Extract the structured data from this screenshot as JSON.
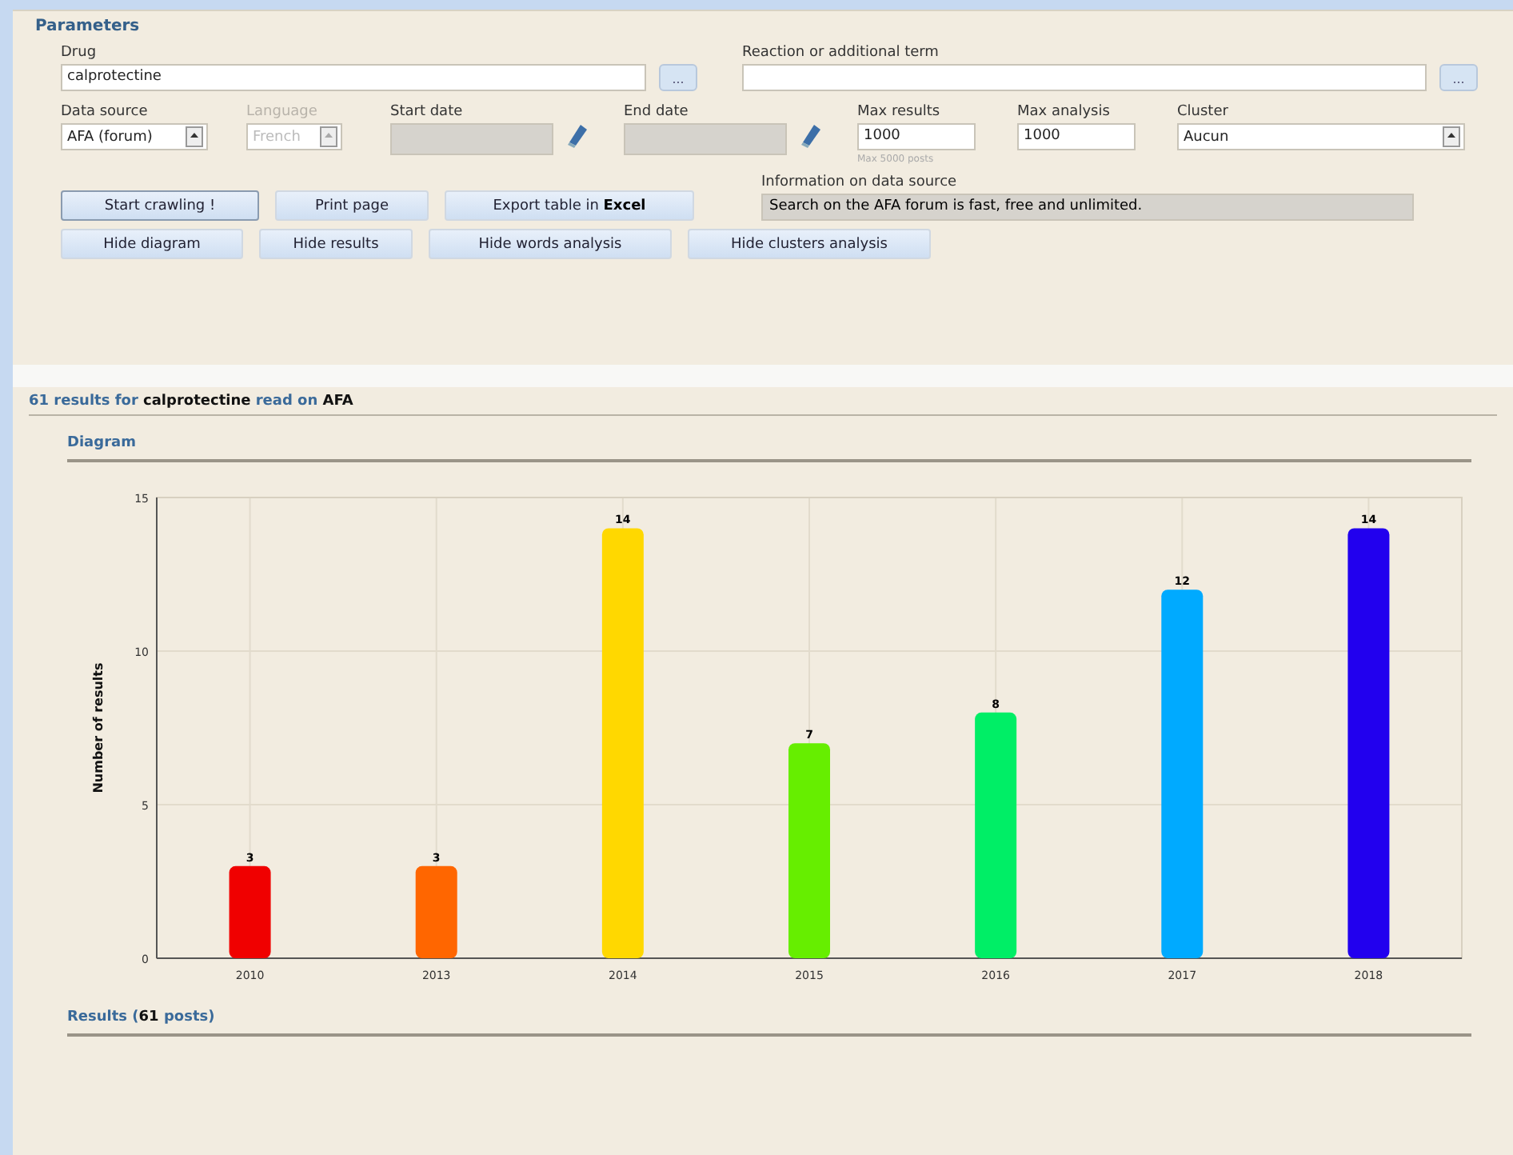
{
  "parameters": {
    "title": "Parameters",
    "drug": {
      "label": "Drug",
      "value": "calprotectine",
      "button": "..."
    },
    "reaction": {
      "label": "Reaction or additional term",
      "button": "..."
    },
    "data_source": {
      "label": "Data source",
      "value": "AFA (forum)"
    },
    "language": {
      "label": "Language",
      "value": "French",
      "disabled": true
    },
    "start_date": {
      "label": "Start date",
      "disabled": true
    },
    "end_date": {
      "label": "End date",
      "disabled": true
    },
    "max_results": {
      "label": "Max results",
      "value": "1000",
      "hint": "Max 5000 posts"
    },
    "max_analysis": {
      "label": "Max analysis",
      "value": "1000"
    },
    "cluster": {
      "label": "Cluster",
      "value": "Aucun"
    },
    "info": {
      "label": "Information on data source",
      "value": "Search on the AFA forum is fast, free and unlimited."
    },
    "action_buttons": [
      {
        "label": "Start crawling !",
        "focused": true
      },
      {
        "label": "Print page",
        "focused": false
      },
      {
        "label": "Export table in **Excel**",
        "focused": false
      }
    ],
    "toggle_buttons": [
      {
        "label": "Hide diagram"
      },
      {
        "label": "Hide results"
      },
      {
        "label": "Hide words analysis"
      },
      {
        "label": "Hide clusters analysis"
      }
    ]
  },
  "results_heading": "61 results for **calprotectine** read on **AFA**",
  "diagram": {
    "title": "Diagram",
    "chart_data": {
      "type": "bar",
      "ylabel": "Number of results",
      "categories": [
        "2010",
        "2013",
        "2014",
        "2015",
        "2016",
        "2017",
        "2018"
      ],
      "series": [
        {
          "values": [
            3,
            3,
            14,
            7,
            8,
            12,
            14
          ]
        }
      ],
      "colors": [
        "#f00000",
        "#ff6600",
        "#ffd800",
        "#66ee00",
        "#00ee66",
        "#00aaff",
        "#2200ee"
      ],
      "ylim": [
        0,
        15
      ],
      "yticks": [
        0,
        5,
        10,
        15
      ],
      "grid": true,
      "data_labels": true
    }
  },
  "results_title": "Results (**61** posts)"
}
